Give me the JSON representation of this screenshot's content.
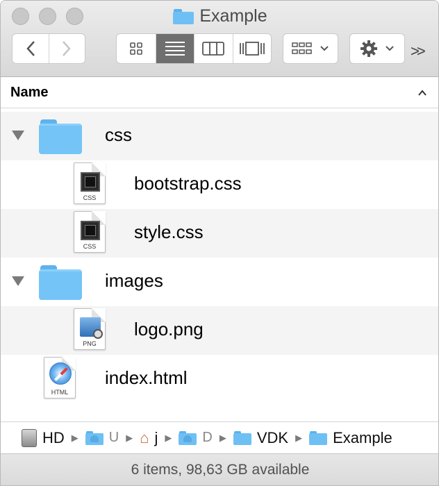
{
  "window": {
    "title": "Example"
  },
  "toolbar": {
    "back_icon": "chevron-left-icon",
    "forward_icon": "chevron-right-icon",
    "view_modes": [
      "icon-view",
      "list-view",
      "column-view",
      "cover-flow-view"
    ],
    "active_view": "list-view",
    "arrange_icon": "arrange-grid-icon",
    "action_icon": "gear-icon",
    "overflow_label": ">>"
  },
  "columns": {
    "name_label": "Name",
    "sort": "ascending"
  },
  "files": [
    {
      "label": "css",
      "kind": "folder",
      "indent": 0,
      "expanded": true
    },
    {
      "label": "bootstrap.css",
      "kind": "css",
      "indent": 1,
      "ext": "CSS"
    },
    {
      "label": "style.css",
      "kind": "css",
      "indent": 1,
      "ext": "CSS"
    },
    {
      "label": "images",
      "kind": "folder",
      "indent": 0,
      "expanded": true
    },
    {
      "label": "logo.png",
      "kind": "png",
      "indent": 1,
      "ext": "PNG"
    },
    {
      "label": "index.html",
      "kind": "html",
      "indent": 0,
      "ext": "HTML"
    }
  ],
  "pathbar": {
    "crumbs": [
      {
        "label": "HD",
        "icon": "hard-disk-icon"
      },
      {
        "label": "U",
        "icon": "users-folder-icon"
      },
      {
        "label": "j",
        "icon": "home-icon"
      },
      {
        "label": "D",
        "icon": "documents-folder-icon"
      },
      {
        "label": "VDK",
        "icon": "folder-icon"
      },
      {
        "label": "Example",
        "icon": "folder-icon"
      }
    ]
  },
  "status": {
    "text": "6 items, 98,63 GB available"
  },
  "colors": {
    "folder_blue": "#74c4f7",
    "alt_row": "#f4f4f4",
    "active_segment": "#6f6f6f"
  }
}
